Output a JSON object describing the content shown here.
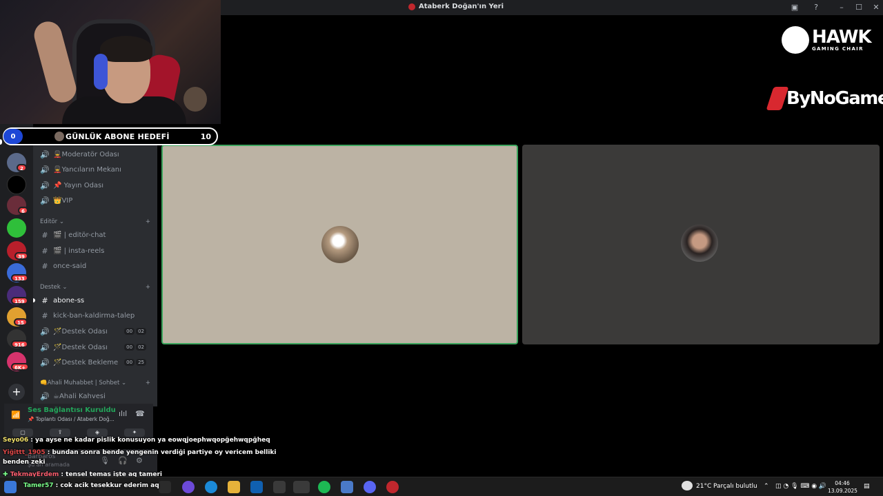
{
  "window": {
    "title": "Ataberk Doğan'ın Yeri",
    "controls": [
      "–",
      "☐",
      "✕"
    ]
  },
  "goal": {
    "label": "GÜNLÜK ABONE HEDEFİ",
    "start": "0",
    "target": "10"
  },
  "servers": [
    {
      "badge": "2"
    },
    {
      "badge": ""
    },
    {
      "badge": "6"
    },
    {
      "badge": ""
    },
    {
      "badge": "39"
    },
    {
      "badge": "133"
    },
    {
      "badge": "159"
    },
    {
      "badge": "15"
    },
    {
      "badge": "916"
    },
    {
      "badge": "6K+"
    }
  ],
  "channels": {
    "voice_top": [
      {
        "icon": "🔊",
        "label": "💂Moderatör Odası"
      },
      {
        "icon": "🔊",
        "label": "💂Yancıların Mekanı"
      },
      {
        "icon": "🔊",
        "label": "📌 Yayın Odası"
      },
      {
        "icon": "🔊",
        "label": "👑VIP"
      }
    ],
    "cat_editor": "Editör ⌄",
    "editor": [
      {
        "icon": "#",
        "label": "🎬 | editör-chat"
      },
      {
        "icon": "#",
        "label": "🎬 | insta-reels"
      },
      {
        "icon": "#",
        "label": "once-said"
      }
    ],
    "cat_destek": "Destek ⌄",
    "destek": [
      {
        "icon": "#",
        "label": "abone-ss"
      },
      {
        "icon": "#",
        "label": "kick-ban-kaldirma-talep"
      },
      {
        "icon": "🔊",
        "label": "🪄Destek Odası",
        "c1": "00",
        "c2": "02"
      },
      {
        "icon": "🔊",
        "label": "🪄Destek Odası",
        "c1": "00",
        "c2": "02"
      },
      {
        "icon": "🔊",
        "label": "🪄Destek Bekleme",
        "c1": "00",
        "c2": "25"
      }
    ],
    "cat_ahali": "👊Ahali Muhabbet | Sohbet ⌄",
    "ahali": [
      {
        "icon": "🔊",
        "label": "☕Ahali Kahvesi"
      }
    ]
  },
  "voice": {
    "status": "Ses Bağlantısı Kuruldu",
    "sub": "📌 Toplantı Odası / Ataberk Doğ..."
  },
  "user": {
    "name": "Barbaros",
    "status": "Şu an aramada"
  },
  "sponsors": {
    "hawk_name": "HAWK",
    "hawk_sub": "GAMING CHAIR",
    "bng_name": "ByNoGame"
  },
  "chat": [
    {
      "user": "Seyo06",
      "text": " : ya ayse ne kadar pislik konusuyon ya eowqjoephwqopğehwqpğheq"
    },
    {
      "user": "Yiğittt_1905",
      "text": " : bundan sonra bende yengenin verdiği partiye oy vericem belliki"
    },
    {
      "user": "",
      "text": "benden zeki"
    },
    {
      "user": "TekmayErdem",
      "text": " : tensel temas işte aq tameri"
    },
    {
      "user": "Tamer57",
      "text": " : cok acik tesekkur ederim aq"
    }
  ],
  "taskbar": {
    "temp": "21°C",
    "weather": "Parçalı bulutlu",
    "time": "04:46",
    "date": "13.09.2025"
  }
}
